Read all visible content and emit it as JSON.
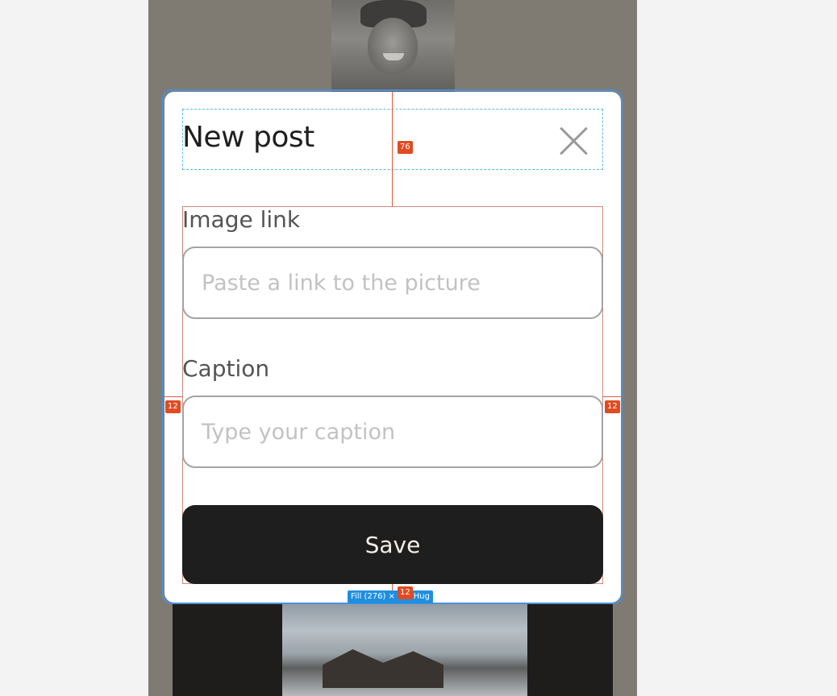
{
  "modal": {
    "title": "New post",
    "close_icon": "close-icon",
    "image_link": {
      "label": "Image link",
      "placeholder": "Paste a link to the picture",
      "value": ""
    },
    "caption": {
      "label": "Caption",
      "placeholder": "Type your caption",
      "value": ""
    },
    "save_label": "Save"
  },
  "design_overlay": {
    "gap_header": "76",
    "padding_left": "12",
    "padding_right": "12",
    "padding_bottom": "12",
    "size_readout": "Fill (276) × 2… Hug"
  },
  "colors": {
    "backdrop": "#7f7b72",
    "button_bg": "#1e1e1e",
    "button_text": "#f5eee4",
    "selection": "#4a90d9",
    "spacing_guide": "#e04b22"
  }
}
